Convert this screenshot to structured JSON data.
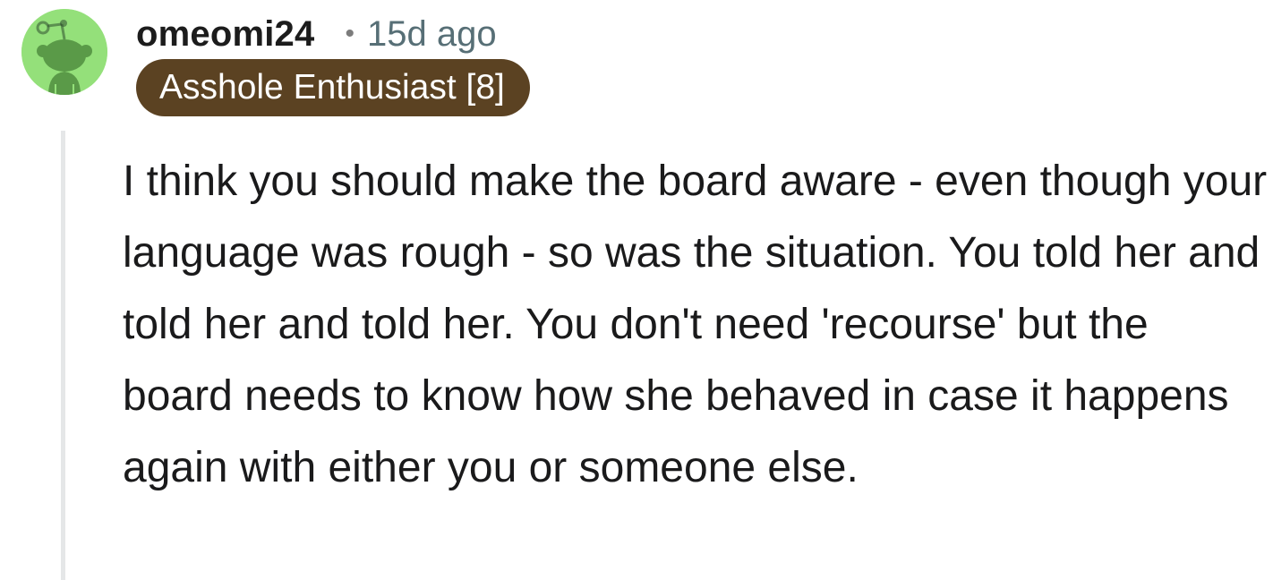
{
  "comment": {
    "username": "omeomi24",
    "separator": "•",
    "timestamp": "15d ago",
    "flair": "Asshole Enthusiast [8]",
    "flair_color": "#5b4222",
    "avatar_icon": "reddit-snoo-avatar-icon",
    "avatar_color": "#94e07a",
    "body": "I think you should make the board aware - even though your language was rough - so was the situation. You told her and told her and told her. You don't need 'recourse' but the board needs to know how she behaved in case it happens again with either you or someone else."
  }
}
